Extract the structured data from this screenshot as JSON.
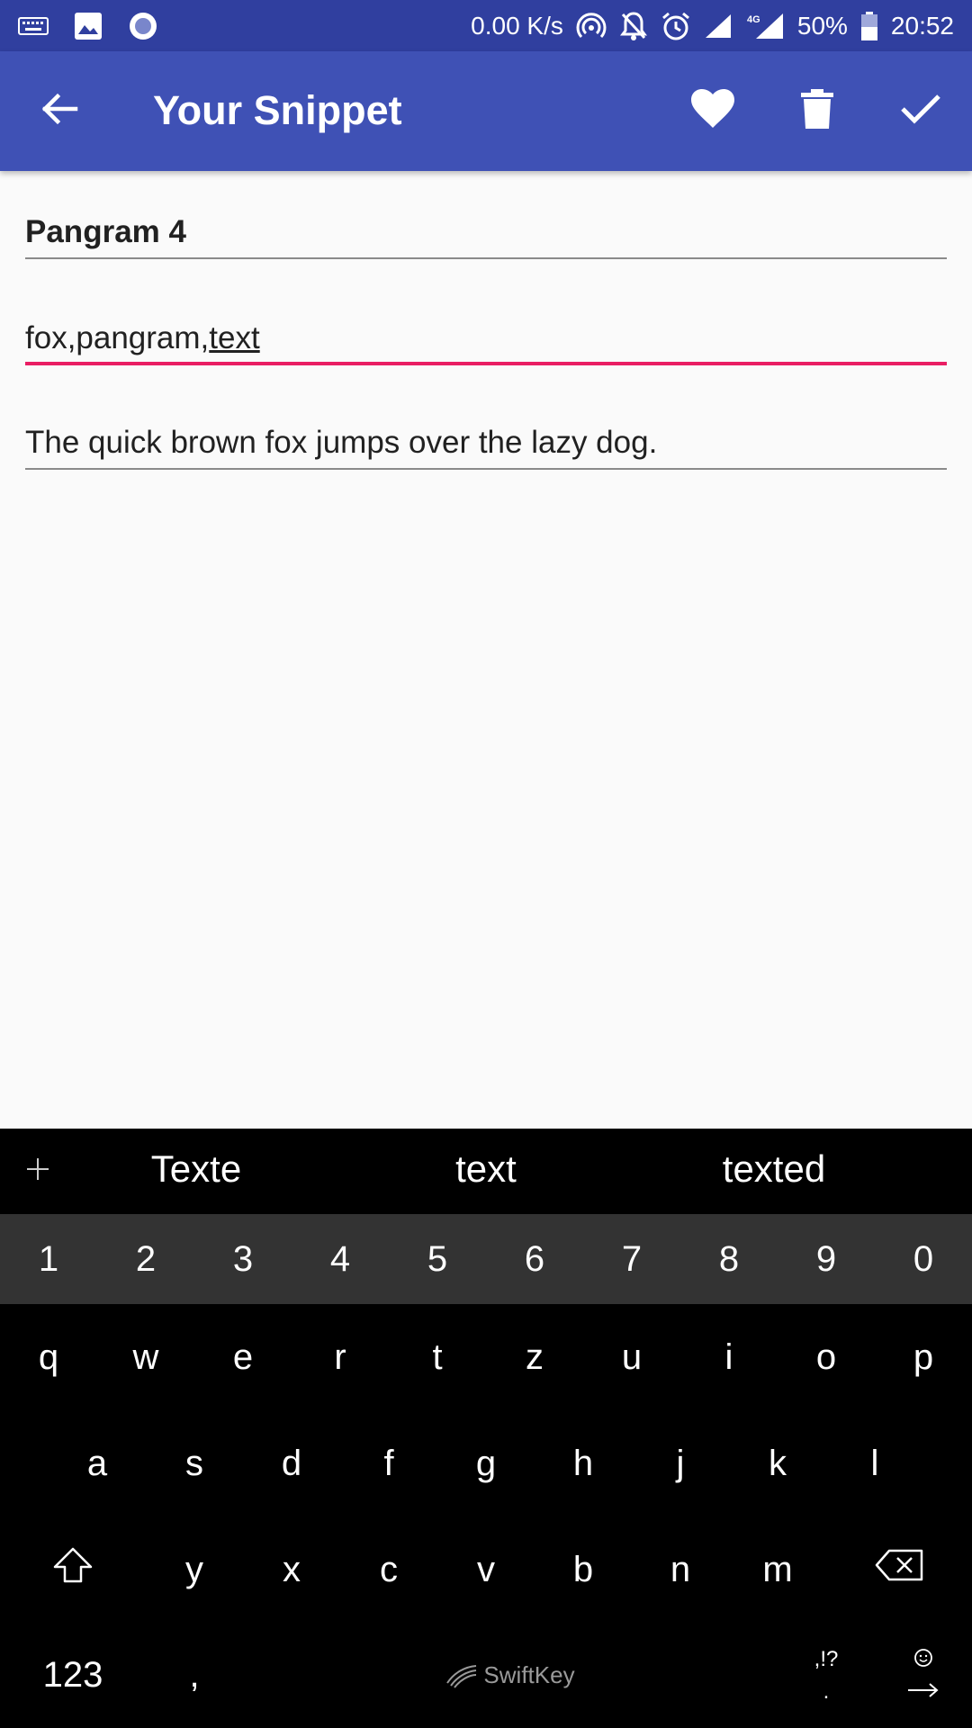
{
  "status_bar": {
    "net_speed": "0.00 K/s",
    "network": "4G",
    "battery": "50%",
    "time": "20:52",
    "icons": [
      "keyboard-icon",
      "image-icon",
      "circle-app-icon",
      "hotspot-icon",
      "bell-off-icon",
      "alarm-icon",
      "signal-icon",
      "signal-4g-icon",
      "battery-icon"
    ]
  },
  "app_bar": {
    "title": "Your Snippet",
    "color": "#3f51b5",
    "actions": [
      "back-arrow-icon",
      "heart-icon",
      "trash-icon",
      "check-icon"
    ]
  },
  "form": {
    "title_value": "Pangram 4",
    "tags_prefix": "fox,pangram,",
    "tags_composing": "text",
    "body_value": "The quick brown fox jumps over the lazy dog.",
    "focus_color": "#e91e63"
  },
  "keyboard": {
    "suggestions": [
      "Texte",
      "text",
      "texted"
    ],
    "numbers": [
      "1",
      "2",
      "3",
      "4",
      "5",
      "6",
      "7",
      "8",
      "9",
      "0"
    ],
    "row1": [
      "q",
      "w",
      "e",
      "r",
      "t",
      "z",
      "u",
      "i",
      "o",
      "p"
    ],
    "row2": [
      "a",
      "s",
      "d",
      "f",
      "g",
      "h",
      "j",
      "k",
      "l"
    ],
    "row3": [
      "y",
      "x",
      "c",
      "v",
      "b",
      "n",
      "m"
    ],
    "symbols_key": "123",
    "comma_key": ",",
    "brand": "SwiftKey",
    "punct_top": ",!?",
    "punct_bottom": "."
  }
}
